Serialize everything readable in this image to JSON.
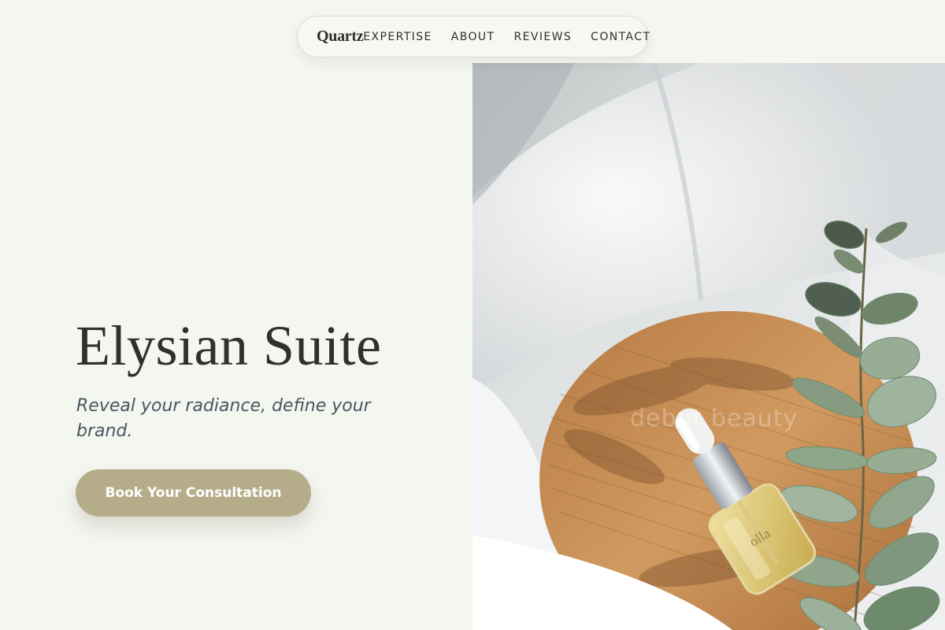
{
  "nav": {
    "logo": "Quartz",
    "links": [
      {
        "label": "EXPERTISE"
      },
      {
        "label": "ABOUT"
      },
      {
        "label": "REVIEWS"
      },
      {
        "label": "CONTACT"
      }
    ]
  },
  "hero": {
    "title": "Elysian Suite",
    "subtitle": "Reveal your radiance, define your brand.",
    "cta_label": "Book Your Consultation",
    "image": {
      "watermark": "debut beauty",
      "bottle_label": "olla"
    }
  },
  "colors": {
    "background": "#f4f6f0",
    "accent": "#b5ad8a",
    "text": "#2f302c"
  }
}
